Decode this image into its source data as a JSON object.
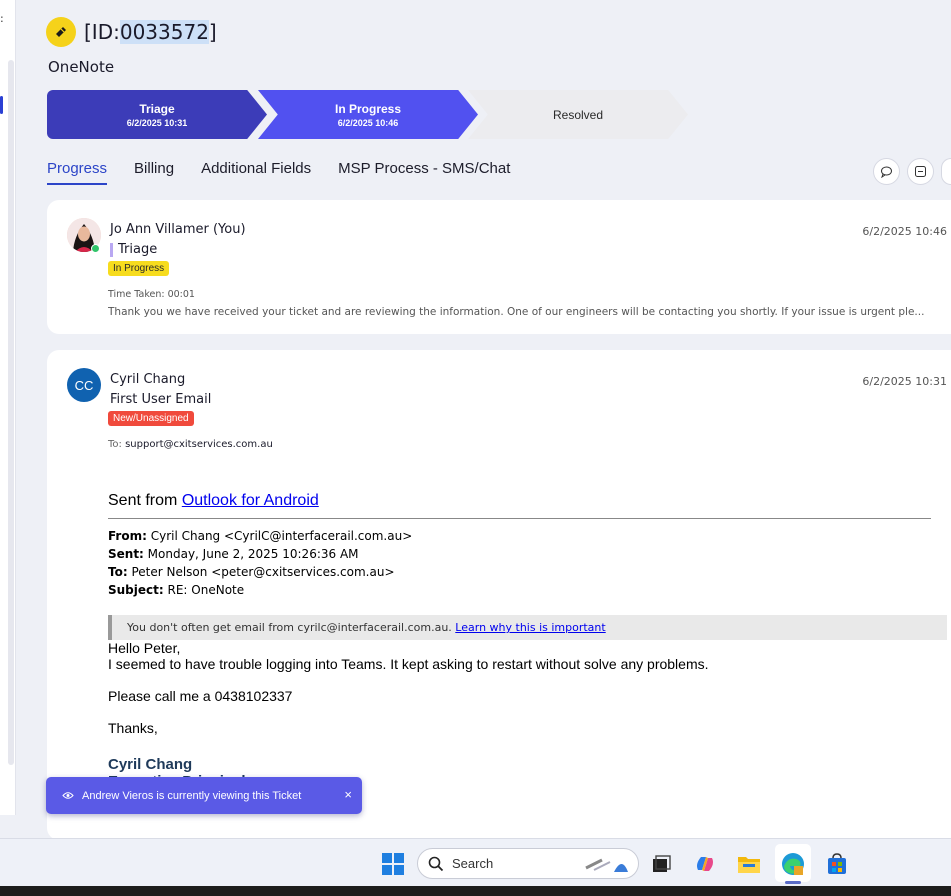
{
  "ticket": {
    "id_prefix": "[ID:",
    "id_number": "0033572",
    "id_suffix": "]",
    "title": "OneNote"
  },
  "stages": [
    {
      "name": "Triage",
      "date": "6/2/2025 10:31"
    },
    {
      "name": "In Progress",
      "date": "6/2/2025 10:46"
    },
    {
      "name": "Resolved",
      "date": ""
    }
  ],
  "tabs": [
    "Progress",
    "Billing",
    "Additional Fields",
    "MSP Process - SMS/Chat"
  ],
  "entries": [
    {
      "author": "Jo Ann Villamer (You)",
      "timestamp": "6/2/2025 10:46",
      "stage": "Triage",
      "status_badge": "In Progress",
      "time_taken": "Time Taken: 00:01",
      "snippet": "Thank you we have received your ticket and are reviewing the information. One of our engineers will be contacting you shortly. If your issue is urgent ple..."
    },
    {
      "author": "Cyril Chang",
      "initials": "CC",
      "timestamp": "6/2/2025 10:31",
      "subject": "First User Email",
      "status_badge": "New/Unassigned",
      "to_label": "To:",
      "to_value": "support@cxitservices.com.au"
    }
  ],
  "email": {
    "sent_from_text": "Sent from ",
    "sent_from_link": "Outlook for Android",
    "from_label": "From:",
    "from_value": " Cyril Chang <CyrilC@interfacerail.com.au>",
    "sent_label": "Sent:",
    "sent_value": " Monday, June 2, 2025 10:26:36 AM",
    "to_label": "To:",
    "to_value": " Peter Nelson <peter@cxitservices.com.au>",
    "subject_label": "Subject:",
    "subject_value": " RE: OneNote",
    "warning_text": "You don't often get email from cyrilc@interfacerail.com.au. ",
    "warning_link": "Learn why this is important",
    "greeting": "Hello Peter,",
    "line1": "I seemed to have trouble logging into Teams. It kept asking to restart without solve any problems.",
    "line2": "Please call me a 0438102337",
    "thanks": "Thanks,",
    "signature_name": "Cyril Chang",
    "signature_title": "Executive Principal"
  },
  "toast": {
    "text": "Andrew Vieros is currently viewing this Ticket",
    "close": "×"
  },
  "taskbar": {
    "search_label": "Search"
  },
  "colors": {
    "stage_done": "#3c3cb8",
    "stage_current": "#5151f0",
    "stage_pending": "#ececef",
    "accent": "#2c45c8",
    "badge_yellow": "#f7dc1e",
    "badge_red": "#f04a3c"
  },
  "icons": [
    "ticket-icon",
    "comment-icon",
    "collapse-icon",
    "eye-icon",
    "close-icon",
    "windows-start-icon",
    "search-icon",
    "task-view-icon",
    "copilot-icon",
    "file-explorer-icon",
    "edge-icon",
    "store-icon"
  ]
}
